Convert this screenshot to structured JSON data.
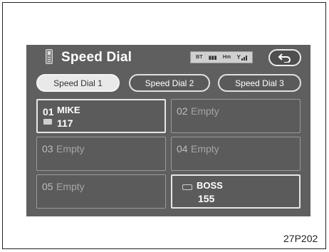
{
  "header": {
    "title": "Speed Dial",
    "status": {
      "bt": "BT",
      "mode": "Hm"
    },
    "back_icon": "back-arrow-icon"
  },
  "tabs": [
    {
      "label": "Speed Dial 1",
      "active": true
    },
    {
      "label": "Speed Dial 2",
      "active": false
    },
    {
      "label": "Speed Dial 3",
      "active": false
    }
  ],
  "slots": [
    {
      "number": "01",
      "name": "MIKE",
      "speed_dial": "117",
      "empty": false
    },
    {
      "number": "02",
      "name": "Empty",
      "empty": true
    },
    {
      "number": "03",
      "name": "Empty",
      "empty": true
    },
    {
      "number": "04",
      "name": "Empty",
      "empty": true
    },
    {
      "number": "05",
      "name": "Empty",
      "empty": true
    },
    {
      "number": "",
      "name": "BOSS",
      "speed_dial": "155",
      "empty": false
    }
  ],
  "figure_code": "27P202",
  "colors": {
    "screen": "#5f5f5f",
    "tab_active": "#e9e9e9",
    "text": "#ffffff"
  }
}
